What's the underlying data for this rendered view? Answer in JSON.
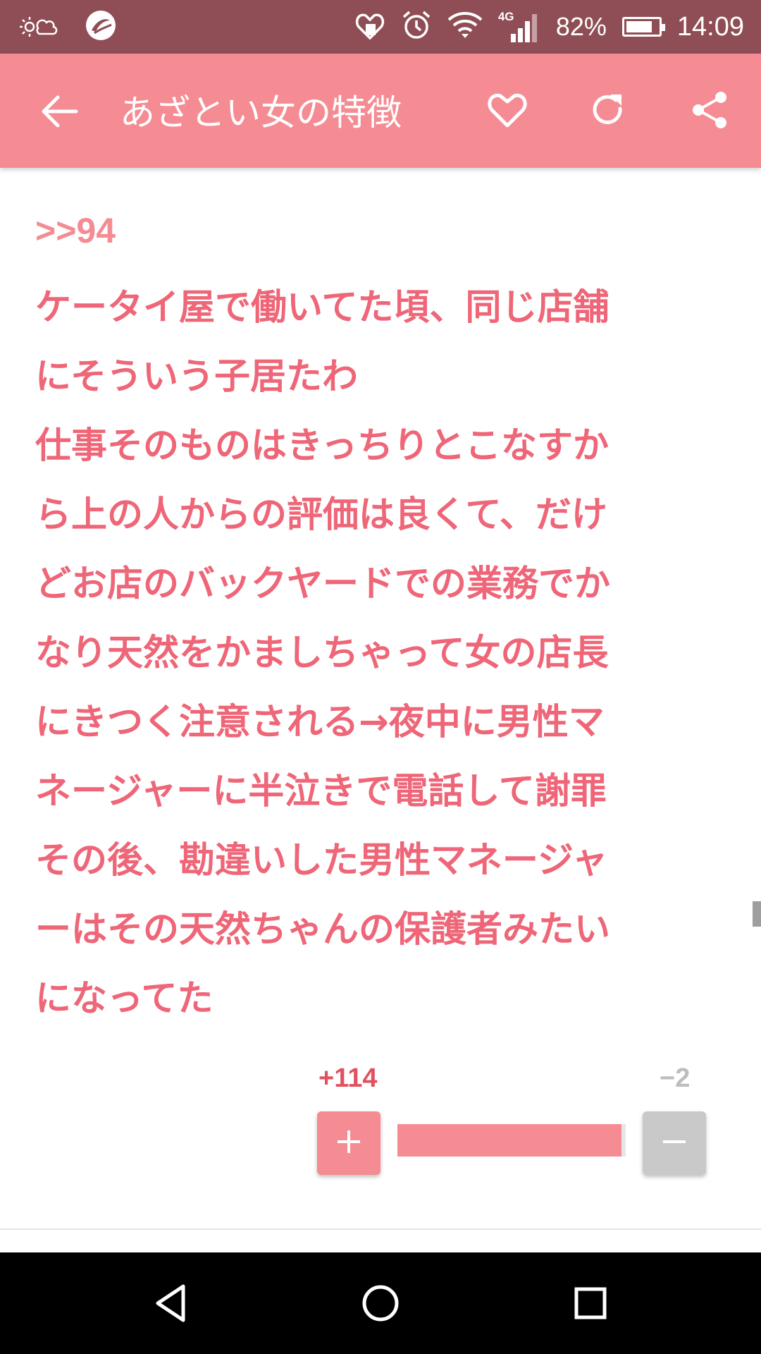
{
  "status_bar": {
    "battery": "82%",
    "battery_level": 0.82,
    "network": "4G",
    "time": "14:09"
  },
  "app_bar": {
    "title": "あざとい女の特徴"
  },
  "post": {
    "reply_ref": ">>94",
    "lines": [
      "ケータイ屋で働いてた頃、同じ店舗",
      "にそういう子居たわ",
      "仕事そのものはきっちりとこなすか",
      "ら上の人からの評価は良くて、だけ",
      "どお店のバックヤードでの業務でか",
      "なり天然をかましちゃって女の店長",
      "にきつく注意される→夜中に男性マ",
      "ネージャーに半泣きで電話して謝罪",
      "その後、勘違いした男性マネージャ",
      "ーはその天然ちゃんの保護者みたい",
      "になってた"
    ]
  },
  "votes": {
    "plus_label": "+114",
    "minus_label": "−2",
    "plus": 114,
    "minus": 2
  },
  "colors": {
    "status_bar": "#8f4e55",
    "app_bar": "#f58b93",
    "body_text": "#ee6677",
    "accent": "#f58b93"
  },
  "icons": {
    "back": "arrow-back-icon",
    "favorite": "heart-outline-icon",
    "reload": "refresh-icon",
    "share": "share-icon"
  }
}
